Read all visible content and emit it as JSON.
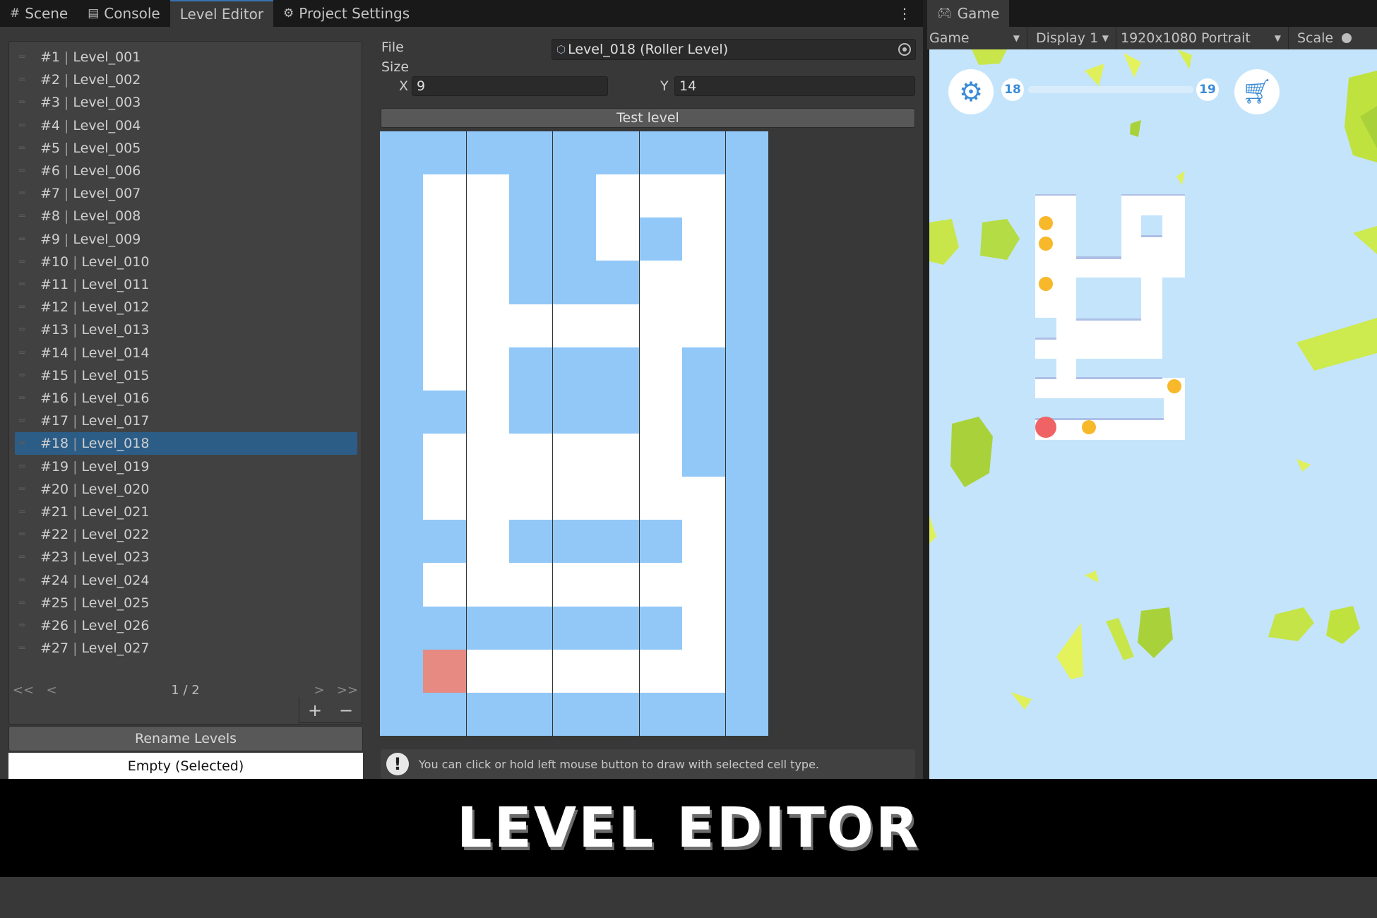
{
  "tabs": [
    {
      "label": "Scene",
      "icon": "grid-icon",
      "active": false
    },
    {
      "label": "Console",
      "icon": "console-icon",
      "active": false
    },
    {
      "label": "Level Editor",
      "icon": "",
      "active": true
    },
    {
      "label": "Project Settings",
      "icon": "gear-icon",
      "active": false
    }
  ],
  "game_tab": {
    "label": "Game",
    "icon": "gamepad-icon"
  },
  "game_toolbar": {
    "mode": "Game",
    "display": "Display 1",
    "resolution": "1920x1080 Portrait",
    "scale_label": "Scale"
  },
  "levels": [
    {
      "num": "#1",
      "name": "Level_001"
    },
    {
      "num": "#2",
      "name": "Level_002"
    },
    {
      "num": "#3",
      "name": "Level_003"
    },
    {
      "num": "#4",
      "name": "Level_004"
    },
    {
      "num": "#5",
      "name": "Level_005"
    },
    {
      "num": "#6",
      "name": "Level_006"
    },
    {
      "num": "#7",
      "name": "Level_007"
    },
    {
      "num": "#8",
      "name": "Level_008"
    },
    {
      "num": "#9",
      "name": "Level_009"
    },
    {
      "num": "#10",
      "name": "Level_010"
    },
    {
      "num": "#11",
      "name": "Level_011"
    },
    {
      "num": "#12",
      "name": "Level_012"
    },
    {
      "num": "#13",
      "name": "Level_013"
    },
    {
      "num": "#14",
      "name": "Level_014"
    },
    {
      "num": "#15",
      "name": "Level_015"
    },
    {
      "num": "#16",
      "name": "Level_016"
    },
    {
      "num": "#17",
      "name": "Level_017"
    },
    {
      "num": "#18",
      "name": "Level_018"
    },
    {
      "num": "#19",
      "name": "Level_019"
    },
    {
      "num": "#20",
      "name": "Level_020"
    },
    {
      "num": "#21",
      "name": "Level_021"
    },
    {
      "num": "#22",
      "name": "Level_022"
    },
    {
      "num": "#23",
      "name": "Level_023"
    },
    {
      "num": "#24",
      "name": "Level_024"
    },
    {
      "num": "#25",
      "name": "Level_025"
    },
    {
      "num": "#26",
      "name": "Level_026"
    },
    {
      "num": "#27",
      "name": "Level_027"
    }
  ],
  "selected_level": "#18",
  "pager": {
    "first": "<<",
    "prev": "<",
    "text": "1 / 2",
    "next": ">",
    "last": ">>"
  },
  "list_buttons": {
    "add": "+",
    "remove": "−"
  },
  "rename_button": "Rename Levels",
  "cell_type_button": "Empty (Selected)",
  "editor": {
    "file_label": "File",
    "file_value": "Level_018 (Roller Level)",
    "size_label": "Size",
    "x_label": "X",
    "x_value": "9",
    "y_label": "Y",
    "y_value": "14",
    "test_button": "Test level",
    "info_message": "You can click or hold left mouse button to draw with selected cell type.",
    "info_icon": "!"
  },
  "grid": {
    "cols": 9,
    "rows": 14,
    "legend": {
      "W": "wall",
      "E": "empty",
      "S": "start"
    },
    "cells": [
      "WWWWWWWWW",
      "WEEWWEEEW",
      "WEEWWEWEW",
      "WEEWWWEEW",
      "WEEEEEEEW",
      "WEEWWWEWW",
      "WWEWWWEWW",
      "WEEEEEEWW",
      "WEEEEEEEW",
      "WWEWWWWEW",
      "WEEEEEEEW",
      "WWWWWWWEW",
      "WSEEEEEEW",
      "WWWWWWWWW"
    ],
    "colors": {
      "wall": "#91c8f8",
      "empty": "#ffffff",
      "start": "#e68a82"
    }
  },
  "game": {
    "settings_icon": "gear-icon",
    "shop_icon": "cart-icon",
    "level_current": "18",
    "level_next": "19",
    "progress": 0
  },
  "caption": "LEVEL EDITOR"
}
